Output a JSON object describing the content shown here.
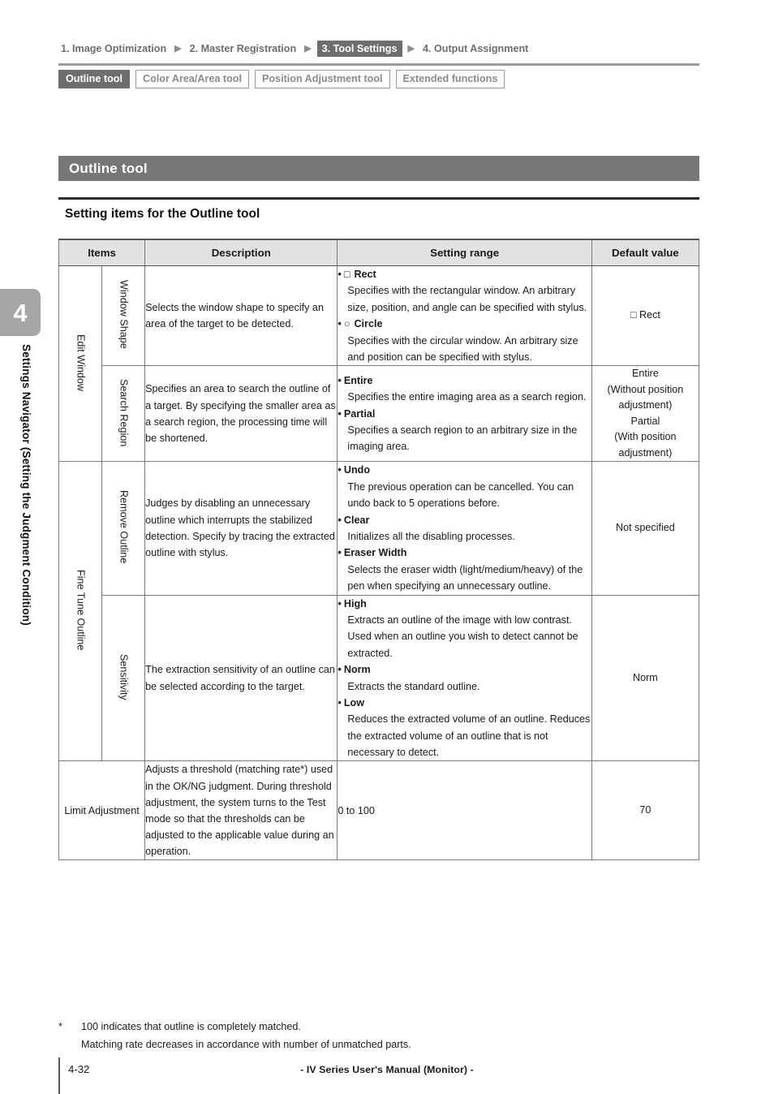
{
  "sidebar": {
    "chapter_number": "4",
    "chapter_title": "Settings Navigator (Setting the Judgment Condition)"
  },
  "breadcrumb": {
    "arrow": "▶",
    "items": [
      {
        "label": "1. Image Optimization",
        "active": false
      },
      {
        "label": "2. Master Registration",
        "active": false
      },
      {
        "label": "3. Tool Settings",
        "active": true
      },
      {
        "label": "4. Output Assignment",
        "active": false
      }
    ]
  },
  "tool_tabs": [
    {
      "label": "Outline tool",
      "active": true
    },
    {
      "label": "Color Area/Area tool",
      "active": false
    },
    {
      "label": "Position Adjustment tool",
      "active": false
    },
    {
      "label": "Extended functions",
      "active": false
    }
  ],
  "section": {
    "title": "Outline tool",
    "subtitle": "Setting items for the Outline tool"
  },
  "table": {
    "headers": {
      "items": "Items",
      "description": "Description",
      "setting_range": "Setting range",
      "default_value": "Default value"
    },
    "groups": [
      {
        "name": "Edit Window"
      },
      {
        "name": "Fine Tune Outline"
      }
    ],
    "rows": {
      "window_shape": {
        "group": "Edit Window",
        "item": "Window Shape",
        "description": "Selects the window shape to specify an area of the  target to be detected.",
        "options": [
          {
            "glyph": "□",
            "name": "Rect",
            "body": "Specifies with the rectangular window. An arbitrary size, position, and angle can be specified with stylus."
          },
          {
            "glyph": "○",
            "name": "Circle",
            "body": "Specifies with the circular window. An arbitrary size and position can be specified with stylus."
          }
        ],
        "default": "□ Rect"
      },
      "search_region": {
        "group": "Edit Window",
        "item": "Search Region",
        "description": "Specifies an area to search the outline of a target. By specifying the smaller area as a search region, the processing time will be shortened.",
        "options": [
          {
            "glyph": "",
            "name": "Entire",
            "body": "Specifies the entire imaging area as a search region."
          },
          {
            "glyph": "",
            "name": "Partial",
            "body": "Specifies a search region to an arbitrary size in the imaging area."
          }
        ],
        "default": "Entire\n(Without position adjustment)\nPartial\n(With position adjustment)",
        "default_lines": [
          "Entire",
          "(Without position",
          "adjustment)",
          "Partial",
          "(With position",
          "adjustment)"
        ]
      },
      "remove_outline": {
        "group": "Fine Tune Outline",
        "item": "Remove Outline",
        "description": "Judges by disabling an unnecessary outline which interrupts the stabilized detection. Specify by tracing the extracted outline with stylus.",
        "options": [
          {
            "glyph": "",
            "name": "Undo",
            "body": "The previous operation can be cancelled. You can undo back to 5 operations before."
          },
          {
            "glyph": "",
            "name": "Clear",
            "body": "Initializes all the disabling processes."
          },
          {
            "glyph": "",
            "name": "Eraser Width",
            "body": "Selects the eraser width (light/medium/heavy) of the pen when specifying an unnecessary outline."
          }
        ],
        "default": "Not specified"
      },
      "sensitivity": {
        "group": "Fine Tune Outline",
        "item": "Sensitivity",
        "description": "The extraction sensitivity of an outline can be selected according to the target.",
        "options": [
          {
            "glyph": "",
            "name": "High",
            "body": "Extracts an outline of the image with low contrast. Used when an outline you wish to detect cannot be extracted."
          },
          {
            "glyph": "",
            "name": "Norm",
            "body": "Extracts the standard outline."
          },
          {
            "glyph": "",
            "name": "Low",
            "body": "Reduces the extracted volume of an outline. Reduces the extracted volume of an outline that is not necessary to detect."
          }
        ],
        "default": "Norm"
      },
      "limit_adjustment": {
        "item": "Limit Adjustment",
        "description": "Adjusts a threshold (matching rate*) used in the OK/NG judgment. During threshold adjustment, the system turns to the Test mode so that the thresholds can be adjusted to the applicable value during an operation.",
        "range": "0 to 100",
        "default": "70"
      }
    }
  },
  "footnote": {
    "marker": "*",
    "line1": "100 indicates that outline is completely matched.",
    "line2": "Matching rate decreases in accordance with number of unmatched parts."
  },
  "footer": {
    "page_number": "4-32",
    "manual_title": "- IV Series User's Manual (Monitor) -"
  },
  "colors": {
    "accent_gray": "#777777",
    "active_tab": "#6e6e6e",
    "tab_fill": "#a6a6a6",
    "header_fill": "#e2e2e2"
  },
  "bullet": "•"
}
